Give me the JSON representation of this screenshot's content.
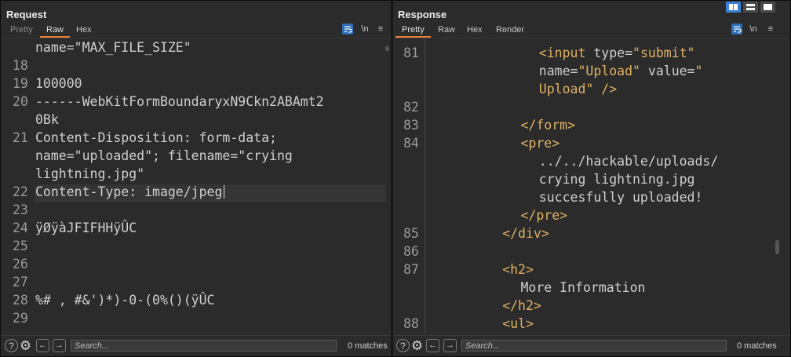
{
  "request": {
    "title": "Request",
    "tabs": [
      "Pretty",
      "Raw",
      "Hex"
    ],
    "lines": [
      {
        "num": "",
        "text": "name=\"MAX_FILE_SIZE\""
      },
      {
        "num": "18",
        "text": ""
      },
      {
        "num": "19",
        "text": "100000"
      },
      {
        "num": "20",
        "text": "------WebKitFormBoundaryxN9Ckn2ABAmt2"
      },
      {
        "num": "",
        "text": "0Bk"
      },
      {
        "num": "21",
        "text": "Content-Disposition: form-data;"
      },
      {
        "num": "",
        "text": "name=\"uploaded\"; filename=\"crying"
      },
      {
        "num": "",
        "text": "lightning.jpg\""
      },
      {
        "num": "22",
        "text": "Content-Type: image/jpeg"
      },
      {
        "num": "23",
        "text": ""
      },
      {
        "num": "24",
        "text": "ÿØÿàJFIFHHÿÛC"
      },
      {
        "num": "25",
        "text": ""
      },
      {
        "num": "26",
        "text": ""
      },
      {
        "num": "27",
        "text": ""
      },
      {
        "num": "28",
        "text": "%# , #&')*)-0-(0%()(ÿÛC"
      },
      {
        "num": "29",
        "text": ""
      }
    ],
    "search_placeholder": "Search...",
    "matches": "0 matches"
  },
  "response": {
    "title": "Response",
    "tabs": [
      "Pretty",
      "Raw",
      "Hex",
      "Render"
    ],
    "lines": [
      {
        "num": "81",
        "indent": 7,
        "parts": [
          [
            "t",
            "<input "
          ],
          [
            "a",
            "type="
          ],
          [
            "s",
            "\"submit\""
          ]
        ]
      },
      {
        "num": "",
        "indent": 7,
        "parts": [
          [
            "a",
            "name="
          ],
          [
            "s",
            "\"Upload\""
          ],
          [
            "a",
            " value="
          ],
          [
            "s",
            "\""
          ]
        ]
      },
      {
        "num": "",
        "indent": 7,
        "parts": [
          [
            "s",
            "Upload\""
          ],
          [
            "t",
            " />"
          ]
        ]
      },
      {
        "num": "82",
        "indent": 0,
        "parts": []
      },
      {
        "num": "83",
        "indent": 6,
        "parts": [
          [
            "t",
            "</form>"
          ]
        ]
      },
      {
        "num": "84",
        "indent": 6,
        "parts": [
          [
            "t",
            "<pre>"
          ]
        ]
      },
      {
        "num": "",
        "indent": 7,
        "parts": [
          [
            "a",
            "../../hackable/uploads/"
          ]
        ]
      },
      {
        "num": "",
        "indent": 7,
        "parts": [
          [
            "a",
            "crying lightning.jpg"
          ]
        ]
      },
      {
        "num": "",
        "indent": 7,
        "parts": [
          [
            "a",
            "succesfully uploaded!"
          ]
        ]
      },
      {
        "num": "",
        "indent": 6,
        "parts": [
          [
            "t",
            "</pre>"
          ]
        ]
      },
      {
        "num": "85",
        "indent": 5,
        "parts": [
          [
            "t",
            "</div>"
          ]
        ]
      },
      {
        "num": "86",
        "indent": 0,
        "parts": []
      },
      {
        "num": "87",
        "indent": 5,
        "parts": [
          [
            "t",
            "<h2>"
          ]
        ]
      },
      {
        "num": "",
        "indent": 6,
        "parts": [
          [
            "a",
            "More Information"
          ]
        ]
      },
      {
        "num": "",
        "indent": 5,
        "parts": [
          [
            "t",
            "</h2>"
          ]
        ]
      },
      {
        "num": "88",
        "indent": 5,
        "parts": [
          [
            "t",
            "<ul>"
          ]
        ]
      }
    ],
    "search_placeholder": "Search...",
    "matches": "0 matches"
  },
  "icons": {
    "wrap": "word-wrap-icon",
    "newline": "\\n",
    "menu": "≡",
    "help": "?",
    "settings": "⚙",
    "back": "←",
    "forward": "→"
  }
}
